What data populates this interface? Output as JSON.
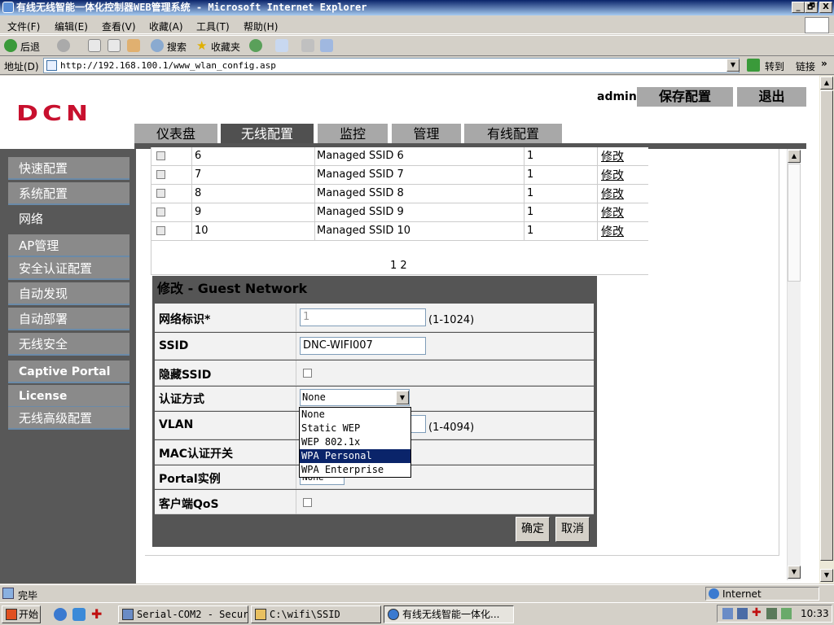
{
  "window": {
    "title": "有线无线智能一体化控制器WEB管理系统 - Microsoft Internet Explorer",
    "minimize": "_",
    "restore": "🗗",
    "close": "X"
  },
  "menu": [
    "文件(F)",
    "编辑(E)",
    "查看(V)",
    "收藏(A)",
    "工具(T)",
    "帮助(H)"
  ],
  "toolbar": {
    "back": "后退",
    "search": "搜索",
    "favorites": "收藏夹"
  },
  "address": {
    "label": "地址(D)",
    "url": "http://192.168.100.1/www_wlan_config.asp",
    "go": "转到",
    "links": "链接"
  },
  "header": {
    "logo": "DCN",
    "user": "admin",
    "save_config": "保存配置",
    "logout": "退出"
  },
  "nav_tabs": [
    "仪表盘",
    "无线配置",
    "监控",
    "管理",
    "有线配置"
  ],
  "nav_active": "无线配置",
  "sidebar": [
    "快速配置",
    "系统配置",
    "网络",
    "AP管理",
    "安全认证配置",
    "自动发现",
    "自动部署",
    "无线安全",
    "Captive Portal",
    "License",
    "无线高级配置"
  ],
  "ssid_table": {
    "rows": [
      {
        "id": "6",
        "name": "Managed SSID 6",
        "count": "1",
        "action": "修改"
      },
      {
        "id": "7",
        "name": "Managed SSID 7",
        "count": "1",
        "action": "修改"
      },
      {
        "id": "8",
        "name": "Managed SSID 8",
        "count": "1",
        "action": "修改"
      },
      {
        "id": "9",
        "name": "Managed SSID 9",
        "count": "1",
        "action": "修改"
      },
      {
        "id": "10",
        "name": "Managed SSID 10",
        "count": "1",
        "action": "修改"
      }
    ],
    "pages": "1 2"
  },
  "edit_panel": {
    "title": "修改  - Guest Network",
    "network_id_label": "网络标识*",
    "network_id_value": "1",
    "network_id_range": "(1-1024)",
    "ssid_label": "SSID",
    "ssid_value": "DNC-WIFI007",
    "hide_ssid_label": "隐藏SSID",
    "auth_label": "认证方式",
    "auth_value": "None",
    "auth_options": [
      "None",
      "Static WEP",
      "WEP 802.1x",
      "WPA Personal",
      "WPA Enterprise"
    ],
    "auth_highlighted": "WPA Personal",
    "vlan_label": "VLAN",
    "vlan_range": "(1-4094)",
    "mac_auth_label": "MAC认证开关",
    "portal_label": "Portal实例",
    "portal_value": "None",
    "qos_label": "客户端QoS",
    "confirm": "确定",
    "cancel": "取消"
  },
  "status": {
    "text": "完毕",
    "zone": "Internet"
  },
  "taskbar": {
    "start": "开始",
    "tasks": [
      "Serial-COM2 - Secur...",
      "C:\\wifi\\SSID",
      "有线无线智能一体化..."
    ],
    "time": "10:33"
  }
}
